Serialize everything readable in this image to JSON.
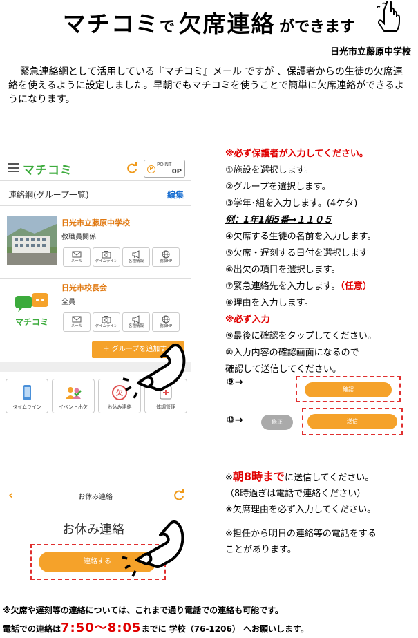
{
  "header": {
    "title_a": "マチコミ",
    "title_b": "で",
    "title_c": "欠席連絡",
    "title_d": "ができます",
    "school": "日光市立藤原中学校",
    "intro": "緊急連絡網として活用している『マチコミ』メール ですが 、保護者からの生徒の欠席連絡を使えるように設定しました。早朝でもマチコミを使うことで簡単に欠席連絡ができるようになります。"
  },
  "phone1": {
    "app_name": "マチコミ",
    "point_label": "POINT",
    "point_value": "0P",
    "point_coin": "P",
    "list_title": "連絡網(グループ一覧)",
    "edit": "編集",
    "groups": [
      {
        "name": "日光市立藤原中学校",
        "sub": "教職員関係"
      },
      {
        "name": "日光市校長会",
        "sub": "全員",
        "logo_text": "マチコミ"
      }
    ],
    "group_buttons": [
      "メール",
      "タイムライン",
      "各種情報",
      "施設HP"
    ],
    "add_group": "＋ グループを追加する",
    "tiles": [
      "タイムライン",
      "イベント出欠",
      "お休み連絡",
      "体調管理"
    ]
  },
  "steps": {
    "must_guardian": "※必ず保護者が入力してください。",
    "s1": "①施設を選択します。",
    "s2": "②グループを選択します。",
    "s3": "③学年･組を入力します。(4ケタ)",
    "example": "例：1年1組5番→１１０５",
    "s4": "④欠席する生徒の名前を入力します。",
    "s5": "⑤欠席・遅刻する日付を選択します",
    "s6": "⑥出欠の項目を選択します。",
    "s7": "⑦緊急連絡先を入力します。",
    "s7_opt": "（任意）",
    "s8": "⑧理由を入力します。",
    "must_input": "※必ず入力",
    "s9": "⑨最後に確認をタップしてください。",
    "s10a": "⑩入力内容の確認画面になるので",
    "s10b": "確認して送信してください。",
    "arrow9": "⑨→",
    "arrow10": "⑩→",
    "confirm_btn": "確認",
    "fix_btn": "修正",
    "send_btn": "送信"
  },
  "phone2": {
    "title": "お休み連絡",
    "big": "お休み連絡",
    "button": "連絡する"
  },
  "notes": {
    "n1_mark": "※",
    "n1_red": "朝8時まで",
    "n1_rest": "に送信してください。",
    "n2": "（8時過ぎは電話で連絡ください）",
    "n3": "※欠席理由を必ず入力してください。",
    "n4a": "※担任から明日の連絡等の電話をする",
    "n4b": "ことがあります。"
  },
  "footer": {
    "line1": "※欠席や遅刻等の連絡については、これまで通り電話での連絡も可能です。",
    "line2_a": "電話での連絡は",
    "time": "7:50〜8:05",
    "line2_b": "までに 学校（76-1206） へお願いします。"
  },
  "colors": {
    "orange": "#f5a22a",
    "red": "#e00000",
    "green": "#3cab3c",
    "blue": "#1a6fd1"
  }
}
